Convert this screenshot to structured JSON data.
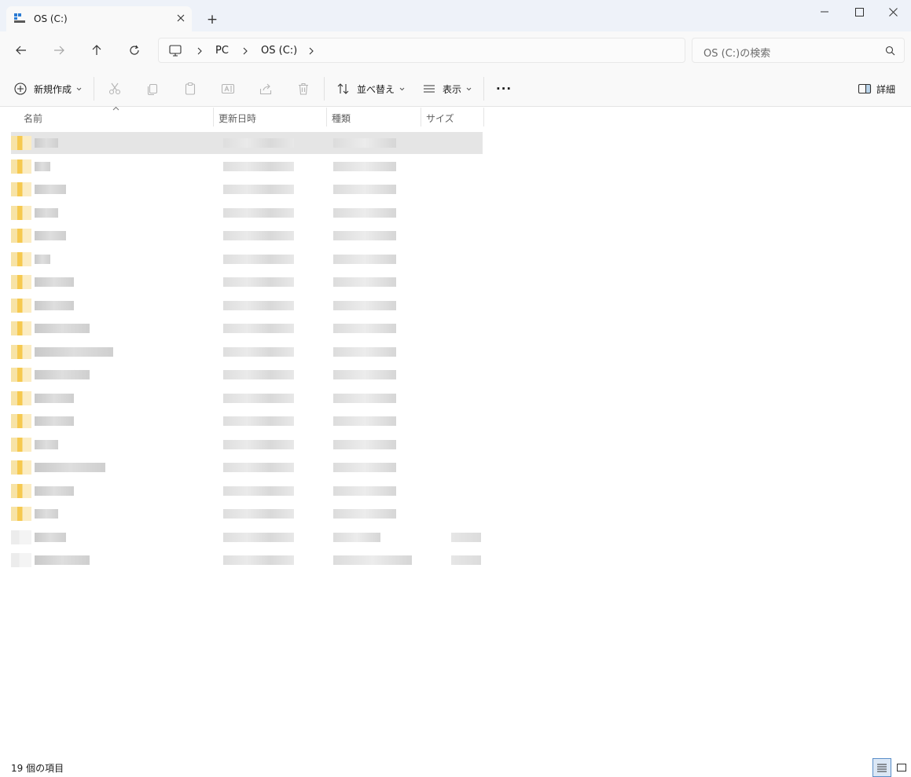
{
  "window": {
    "tab_title": "OS (C:)",
    "new_tab_symbol": "+",
    "controls": [
      "minimize-icon",
      "maximize-icon",
      "close-icon"
    ]
  },
  "nav": {
    "back_icon": "arrow-left-icon",
    "forward_icon": "arrow-right-icon",
    "up_icon": "arrow-up-icon",
    "refresh_icon": "refresh-icon",
    "breadcrumb": [
      "PC",
      "OS (C:)"
    ],
    "search_placeholder": "OS (C:)の検索"
  },
  "commands": {
    "new_label": "新規作成",
    "sort_label": "並べ替え",
    "view_label": "表示",
    "more_label": "···",
    "details_label": "詳細"
  },
  "columns": {
    "name": "名前",
    "modified": "更新日時",
    "type": "種類",
    "size": "サイズ"
  },
  "status": {
    "item_count": "19 個の項目"
  },
  "colors": {
    "titlebar": "#eef2f9",
    "toolbar": "#f9f9f9",
    "folder": "#f6c94f",
    "selection": "#e5e5e5",
    "accent": "#0067c0"
  }
}
